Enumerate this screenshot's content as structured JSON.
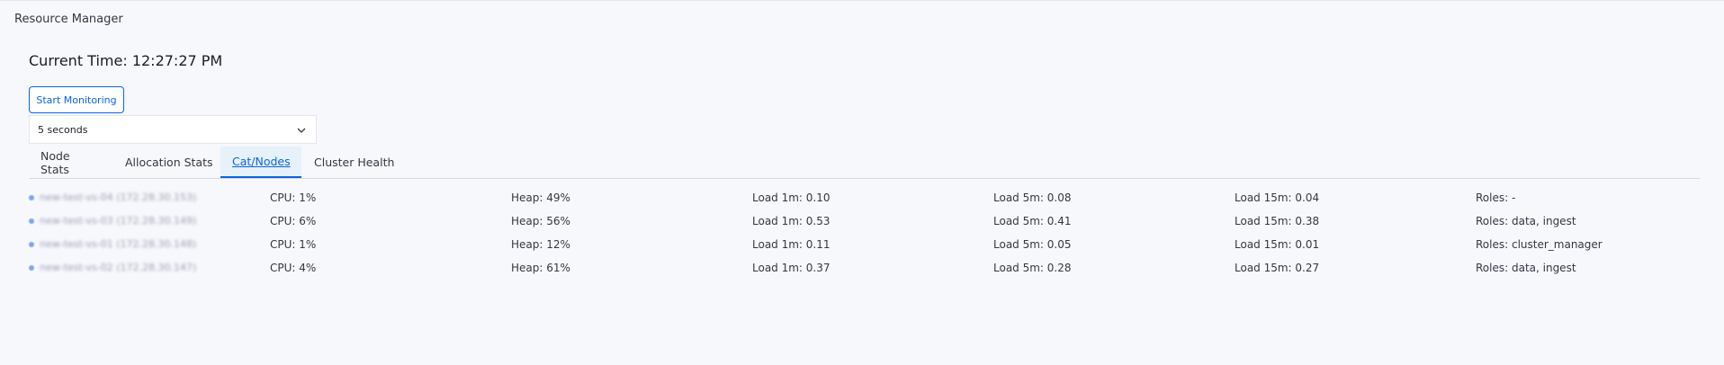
{
  "app": {
    "title": "Resource Manager"
  },
  "header": {
    "current_time": "Current Time: 12:27:27 PM"
  },
  "controls": {
    "start_label": "Start Monitoring",
    "interval_value": "5 seconds"
  },
  "tabs": [
    {
      "label": "Node Stats",
      "active": false
    },
    {
      "label": "Allocation Stats",
      "active": false
    },
    {
      "label": "Cat/Nodes",
      "active": true
    },
    {
      "label": "Cluster Health",
      "active": false
    }
  ],
  "nodes": [
    {
      "name": "new-test-vs-04 (172.28.30.153)",
      "cpu": "CPU: 1%",
      "heap": "Heap: 49%",
      "load1": "Load 1m: 0.10",
      "load5": "Load 5m: 0.08",
      "load15": "Load 15m: 0.04",
      "roles": "Roles: -"
    },
    {
      "name": "new-test-vs-03 (172.28.30.149)",
      "cpu": "CPU: 6%",
      "heap": "Heap: 56%",
      "load1": "Load 1m: 0.53",
      "load5": "Load 5m: 0.41",
      "load15": "Load 15m: 0.38",
      "roles": "Roles: data, ingest"
    },
    {
      "name": "new-test-vs-01 (172.28.30.148)",
      "cpu": "CPU: 1%",
      "heap": "Heap: 12%",
      "load1": "Load 1m: 0.11",
      "load5": "Load 5m: 0.05",
      "load15": "Load 15m: 0.01",
      "roles": "Roles: cluster_manager"
    },
    {
      "name": "new-test-vs-02 (172.28.30.147)",
      "cpu": "CPU: 4%",
      "heap": "Heap: 61%",
      "load1": "Load 1m: 0.37",
      "load5": "Load 5m: 0.28",
      "load15": "Load 15m: 0.27",
      "roles": "Roles: data, ingest"
    }
  ],
  "colors": {
    "accent": "#0b64dd",
    "active_tab_bg": "#e6f1fa",
    "background": "#f7f8fc"
  },
  "icons": {
    "select": "chevron-down-icon",
    "node": "status-dot-icon"
  }
}
